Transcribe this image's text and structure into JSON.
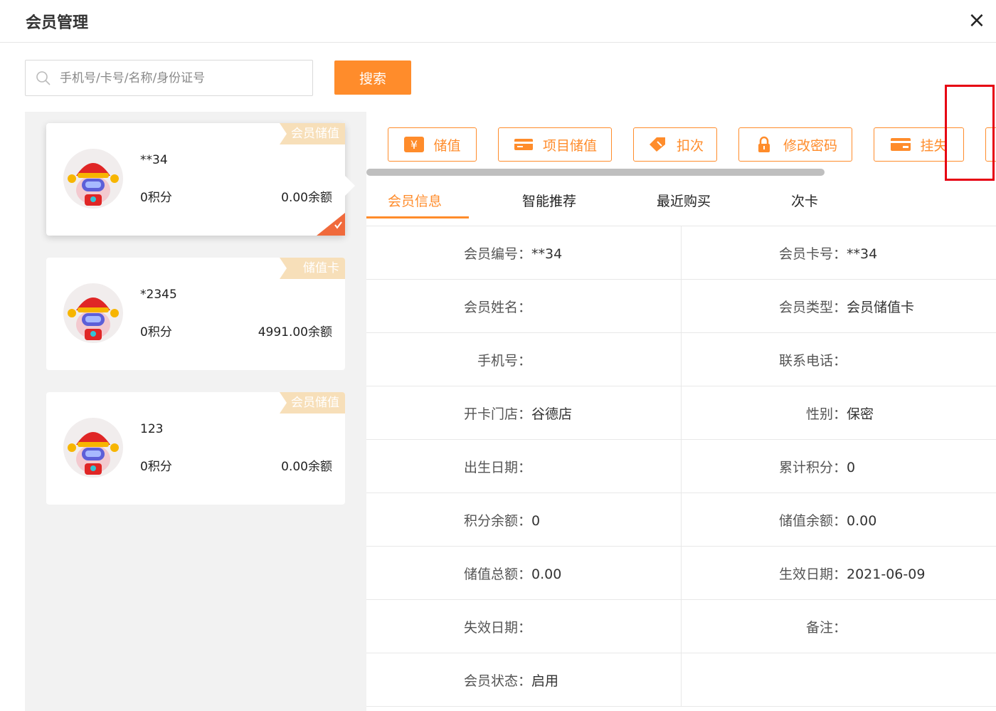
{
  "window": {
    "title": "会员管理",
    "close_label": "×"
  },
  "search": {
    "placeholder": "手机号/卡号/名称/身份证号",
    "value": "",
    "button_label": "搜索"
  },
  "cards": [
    {
      "tag": "会员储值",
      "card_no": "**34",
      "points": "0积分",
      "balance": "0.00余额",
      "selected": true
    },
    {
      "tag": "储值卡",
      "card_no": "*2345",
      "points": "0积分",
      "balance": "4991.00余额",
      "selected": false
    },
    {
      "tag": "会员储值",
      "card_no": "123",
      "points": "0积分",
      "balance": "0.00余额",
      "selected": false
    }
  ],
  "actions": [
    {
      "label": "储值",
      "icon": "yen-icon"
    },
    {
      "label": "项目储值",
      "icon": "card-icon"
    },
    {
      "label": "扣次",
      "icon": "ticket-icon"
    },
    {
      "label": "修改密码",
      "icon": "lock-icon"
    },
    {
      "label": "挂失",
      "icon": "card-report-icon"
    }
  ],
  "tabs": [
    {
      "label": "会员信息",
      "active": true
    },
    {
      "label": "智能推荐",
      "active": false
    },
    {
      "label": "最近购买",
      "active": false
    },
    {
      "label": "次卡",
      "active": false
    }
  ],
  "info": {
    "rows": [
      {
        "left_label": "会员编号：",
        "left_value": "**34",
        "right_label": "会员卡号：",
        "right_value": "**34"
      },
      {
        "left_label": "会员姓名：",
        "left_value": "",
        "right_label": "会员类型：",
        "right_value": "会员储值卡"
      },
      {
        "left_label": "手机号：",
        "left_value": "",
        "right_label": "联系电话：",
        "right_value": ""
      },
      {
        "left_label": "开卡门店：",
        "left_value": "谷德店",
        "right_label": "性别：",
        "right_value": "保密"
      },
      {
        "left_label": "出生日期：",
        "left_value": "",
        "right_label": "累计积分：",
        "right_value": "0"
      },
      {
        "left_label": "积分余额：",
        "left_value": "0",
        "right_label": "储值余额：",
        "right_value": "0.00"
      },
      {
        "left_label": "储值总额：",
        "left_value": "0.00",
        "right_label": "生效日期：",
        "right_value": "2021-06-09"
      },
      {
        "left_label": "失效日期：",
        "left_value": "",
        "right_label": "备注：",
        "right_value": ""
      },
      {
        "left_label": "会员状态：",
        "left_value": "启用",
        "right_label": "",
        "right_value": ""
      }
    ]
  },
  "colors": {
    "accent": "#ff8c2b",
    "tag_bg": "#f7dfb9",
    "highlight_box": "#e60012"
  }
}
